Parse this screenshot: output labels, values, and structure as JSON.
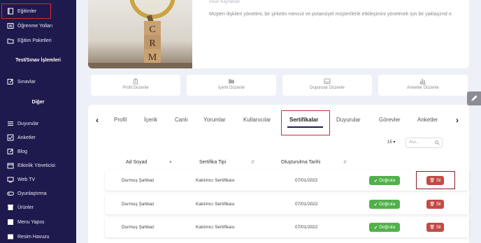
{
  "sidebar": {
    "items": [
      {
        "label": "Eğitimler",
        "icon": "book-icon"
      },
      {
        "label": "Öğrenme Yolları",
        "icon": "list-icon"
      },
      {
        "label": "Eğitim Paketleri",
        "icon": "folder-icon"
      },
      {
        "label": "Sınavlar",
        "icon": "edit-icon"
      },
      {
        "label": "Duyurular",
        "icon": "list-icon"
      },
      {
        "label": "Anketler",
        "icon": "checklist-icon"
      },
      {
        "label": "Blog",
        "icon": "edit-icon"
      },
      {
        "label": "Etkinlik Yöneticisi",
        "icon": "calendar-icon"
      },
      {
        "label": "Web TV",
        "icon": "tv-icon"
      },
      {
        "label": "Oyunlaştırma",
        "icon": "gamepad-icon"
      },
      {
        "label": "Ürünler",
        "icon": "box-icon"
      },
      {
        "label": "Menu Yapısı",
        "icon": "menu-icon"
      },
      {
        "label": "Resim Havuzu",
        "icon": "image-icon"
      }
    ],
    "heading_test": "Test/Sınav İşlemleri",
    "heading_other": "Diğer"
  },
  "header": {
    "faint_text": "İnsan Kaynakları",
    "description": "Müşteri ilişkileri yönetimi, bir şirketin mevcut ve potansiyel müşterilerle etkileşimini yönetmek için bir yaklaşımd ır.",
    "image_letters": [
      "C",
      "R",
      "M"
    ]
  },
  "action_buttons": [
    {
      "label": "Profil Düzenle",
      "icon": "bank-icon"
    },
    {
      "label": "İçerik Düzenle",
      "icon": "folder-icon"
    },
    {
      "label": "Duyurular Düzenle",
      "icon": "inbox-icon"
    },
    {
      "label": "Anketler Düzenle",
      "icon": "bar-chart-icon"
    }
  ],
  "tabs": [
    {
      "label": "Profil"
    },
    {
      "label": "İçerik"
    },
    {
      "label": "Canlı"
    },
    {
      "label": "Yorumlar"
    },
    {
      "label": "Kullanıcılar"
    },
    {
      "label": "Sertifikalar",
      "active": true
    },
    {
      "label": "Duyurular"
    },
    {
      "label": "Görevler"
    },
    {
      "label": "Anketler"
    }
  ],
  "nav": {
    "prev": "‹",
    "next": "›"
  },
  "table": {
    "page_size": "15",
    "search_placeholder": "Ara...",
    "columns": [
      "Ad Soyad",
      "Sertifika Tipi",
      "Oluşturulma Tarihi"
    ],
    "rows": [
      {
        "name": "Durmuş Şahbaz",
        "type": "Katılımcı Sertifikası",
        "date": "07/01/2022",
        "status": "Doğrula",
        "action": "Sil"
      },
      {
        "name": "Durmuş Şahbaz",
        "type": "Katılımcı Sertifikası",
        "date": "07/01/2022",
        "status": "Doğrula",
        "action": "Sil"
      },
      {
        "name": "Durmuş Şahbaz",
        "type": "Katılımcı Sertifikası",
        "date": "07/01/2022",
        "status": "Doğrula",
        "action": "Sil"
      }
    ]
  },
  "colors": {
    "sidebar": "#1f1a4d",
    "accent_green": "#52b04b",
    "accent_red": "#c24b45",
    "highlight": "#e0243a"
  }
}
